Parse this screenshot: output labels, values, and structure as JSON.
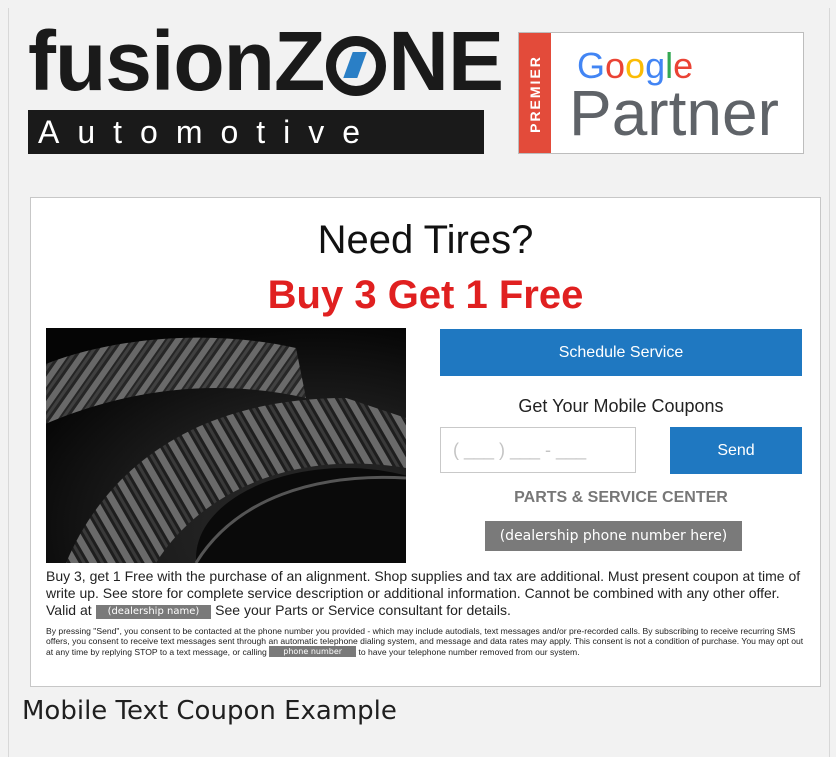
{
  "logos": {
    "fusionzone_title_pre": "fusionZ",
    "fusionzone_title_post": "NE",
    "fusionzone_subtitle": "Automotive",
    "google_premier": "PREMIER",
    "google_word": "Google",
    "google_partner": "Partner"
  },
  "coupon": {
    "headline": "Need Tires?",
    "offer": "Buy 3 Get 1 Free",
    "schedule_button": "Schedule Service",
    "mobile_heading": "Get Your Mobile Coupons",
    "phone_placeholder": "( ___ ) ___ - ___",
    "send_button": "Send",
    "parts_title": "PARTS & SERVICE CENTER",
    "dealer_phone_chip": "(dealership phone number here)",
    "body_text_1": "Buy 3, get 1 Free with the purchase of an alignment. Shop supplies and tax are additional. Must present coupon at time of write up. See store for complete service description or additional information. Cannot be combined with any other offer. Valid at",
    "dealer_name_chip": "(dealership name)",
    "body_text_2": "See your Parts or Service consultant for details.",
    "fine_print_1": "By pressing \"Send\", you consent to be contacted at the phone number you provided - which may include autodials, text messages and/or pre-recorded calls. By subscribing to receive recurring SMS offers, you consent to receive text messages sent through an automatic telephone dialing system, and message and data rates may apply. This consent is not a condition of purchase. You may opt out at any time by replying STOP to a text message, or calling",
    "fine_phone_chip": "phone number",
    "fine_print_2": "to have your telephone number removed from our system."
  },
  "caption": "Mobile Text Coupon Example",
  "colors": {
    "accent_blue": "#1f78c1",
    "offer_red": "#e02020",
    "chip_gray": "#7a7a7a"
  }
}
